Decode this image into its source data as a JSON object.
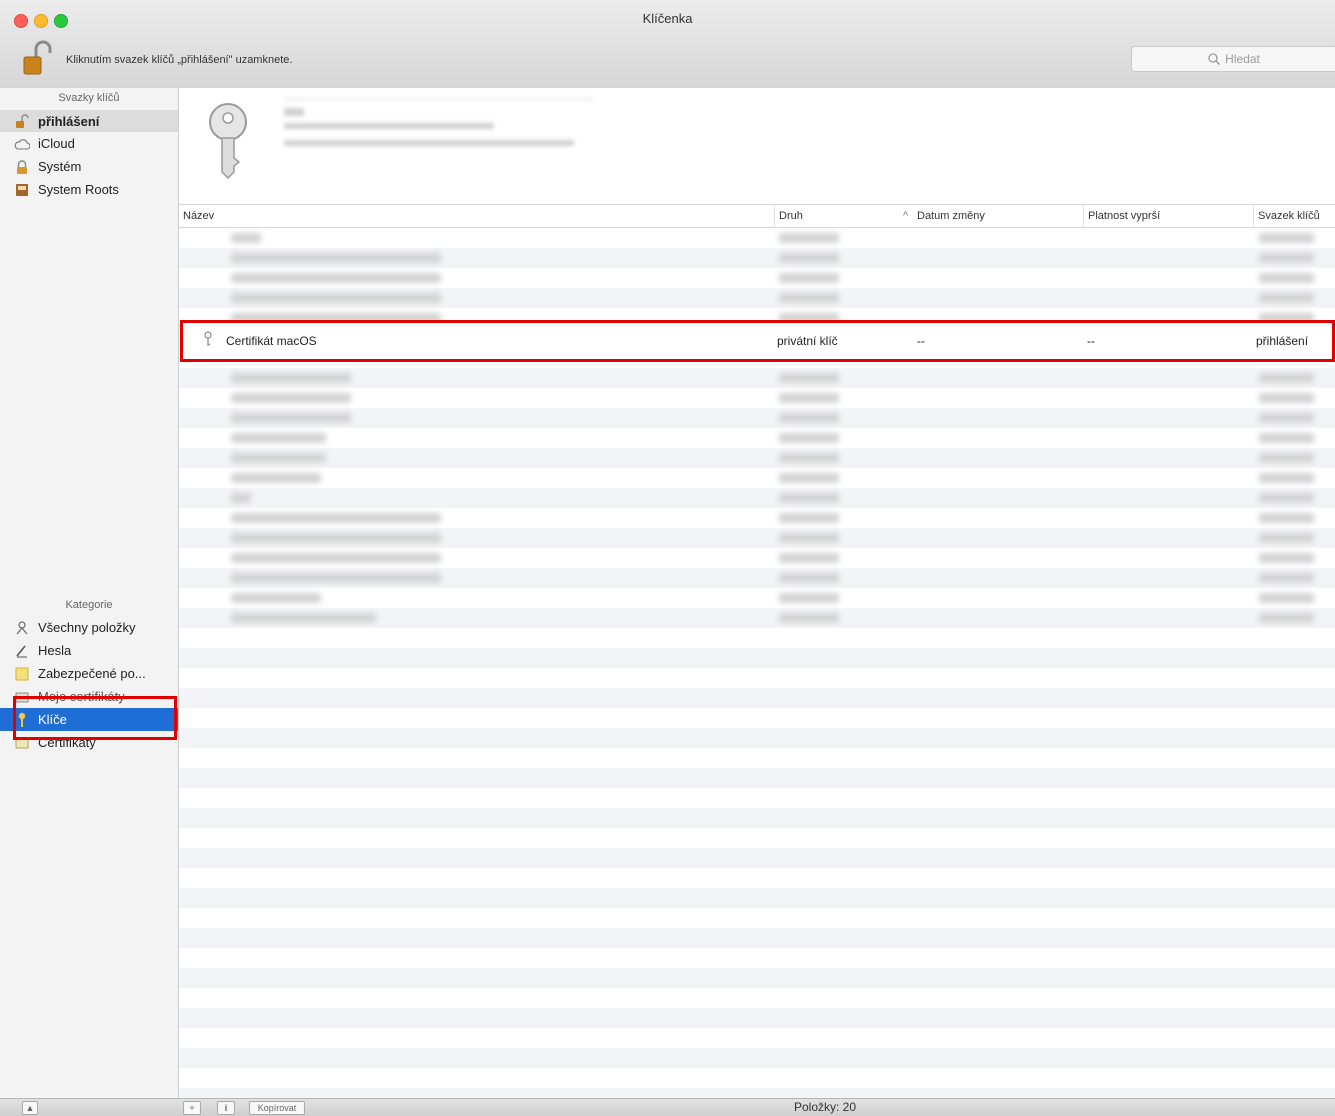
{
  "window": {
    "title": "Klíčenka",
    "lock_message": "Kliknutím svazek klíčů „přihlášení\" uzamknete.",
    "search_placeholder": "Hledat"
  },
  "sidebar": {
    "keychains_header": "Svazky klíčů",
    "keychains": [
      {
        "label": "přihlášení",
        "icon": "open-lock-icon"
      },
      {
        "label": "iCloud",
        "icon": "cloud-icon"
      },
      {
        "label": "Systém",
        "icon": "lock-icon"
      },
      {
        "label": "System Roots",
        "icon": "cabinet-icon"
      }
    ],
    "category_header": "Kategorie",
    "categories": [
      {
        "label": "Všechny položky",
        "icon": "all-items-icon"
      },
      {
        "label": "Hesla",
        "icon": "pencil-icon"
      },
      {
        "label": "Zabezpečené po...",
        "icon": "secure-note-icon"
      },
      {
        "label": "Moje certifikáty",
        "icon": "my-cert-icon"
      },
      {
        "label": "Klíče",
        "icon": "key-icon"
      },
      {
        "label": "Certifikáty",
        "icon": "cert-icon"
      }
    ]
  },
  "table": {
    "columns": [
      "Název",
      "Druh",
      "Datum změny",
      "Platnost vyprší",
      "Svazek klíčů"
    ],
    "highlighted_row": {
      "name": "Certifikát macOS",
      "kind": "privátní klíč",
      "modified": "--",
      "expires": "--",
      "keychain": "přihlášení"
    }
  },
  "footer": {
    "copy_label": "Kopírovat",
    "items_count": "Položky: 20"
  },
  "colors": {
    "selection": "#1f6ed6",
    "highlight_box": "#e00000"
  }
}
